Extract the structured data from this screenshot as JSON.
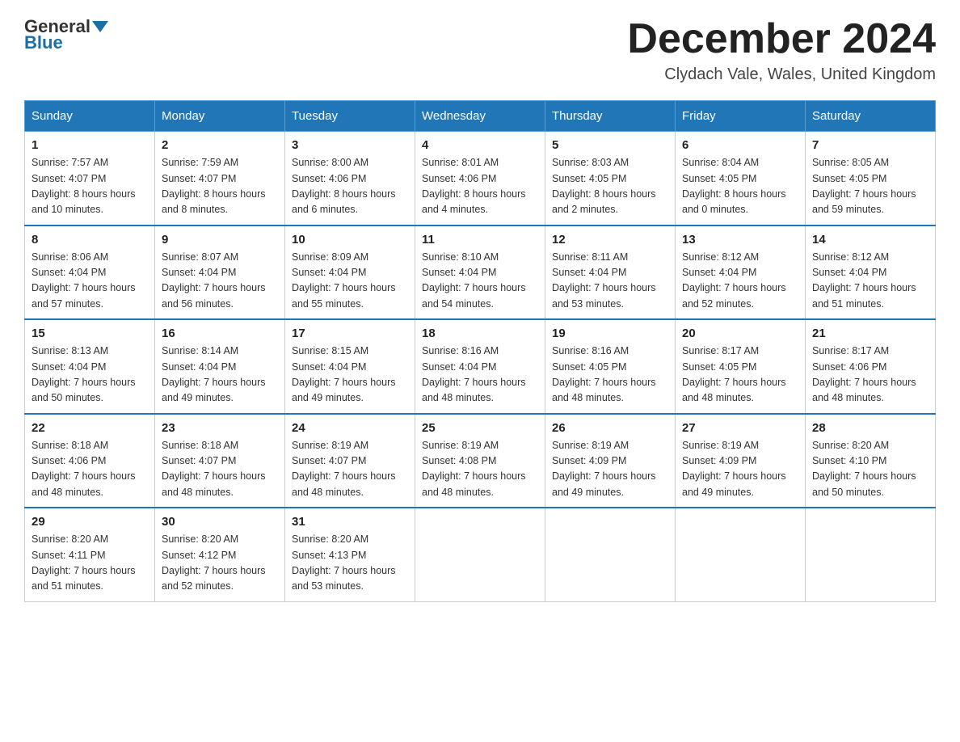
{
  "header": {
    "logo_general": "General",
    "logo_blue": "Blue",
    "month_title": "December 2024",
    "location": "Clydach Vale, Wales, United Kingdom"
  },
  "days_of_week": [
    "Sunday",
    "Monday",
    "Tuesday",
    "Wednesday",
    "Thursday",
    "Friday",
    "Saturday"
  ],
  "weeks": [
    [
      {
        "day": "1",
        "sunrise": "7:57 AM",
        "sunset": "4:07 PM",
        "daylight": "8 hours and 10 minutes."
      },
      {
        "day": "2",
        "sunrise": "7:59 AM",
        "sunset": "4:07 PM",
        "daylight": "8 hours and 8 minutes."
      },
      {
        "day": "3",
        "sunrise": "8:00 AM",
        "sunset": "4:06 PM",
        "daylight": "8 hours and 6 minutes."
      },
      {
        "day": "4",
        "sunrise": "8:01 AM",
        "sunset": "4:06 PM",
        "daylight": "8 hours and 4 minutes."
      },
      {
        "day": "5",
        "sunrise": "8:03 AM",
        "sunset": "4:05 PM",
        "daylight": "8 hours and 2 minutes."
      },
      {
        "day": "6",
        "sunrise": "8:04 AM",
        "sunset": "4:05 PM",
        "daylight": "8 hours and 0 minutes."
      },
      {
        "day": "7",
        "sunrise": "8:05 AM",
        "sunset": "4:05 PM",
        "daylight": "7 hours and 59 minutes."
      }
    ],
    [
      {
        "day": "8",
        "sunrise": "8:06 AM",
        "sunset": "4:04 PM",
        "daylight": "7 hours and 57 minutes."
      },
      {
        "day": "9",
        "sunrise": "8:07 AM",
        "sunset": "4:04 PM",
        "daylight": "7 hours and 56 minutes."
      },
      {
        "day": "10",
        "sunrise": "8:09 AM",
        "sunset": "4:04 PM",
        "daylight": "7 hours and 55 minutes."
      },
      {
        "day": "11",
        "sunrise": "8:10 AM",
        "sunset": "4:04 PM",
        "daylight": "7 hours and 54 minutes."
      },
      {
        "day": "12",
        "sunrise": "8:11 AM",
        "sunset": "4:04 PM",
        "daylight": "7 hours and 53 minutes."
      },
      {
        "day": "13",
        "sunrise": "8:12 AM",
        "sunset": "4:04 PM",
        "daylight": "7 hours and 52 minutes."
      },
      {
        "day": "14",
        "sunrise": "8:12 AM",
        "sunset": "4:04 PM",
        "daylight": "7 hours and 51 minutes."
      }
    ],
    [
      {
        "day": "15",
        "sunrise": "8:13 AM",
        "sunset": "4:04 PM",
        "daylight": "7 hours and 50 minutes."
      },
      {
        "day": "16",
        "sunrise": "8:14 AM",
        "sunset": "4:04 PM",
        "daylight": "7 hours and 49 minutes."
      },
      {
        "day": "17",
        "sunrise": "8:15 AM",
        "sunset": "4:04 PM",
        "daylight": "7 hours and 49 minutes."
      },
      {
        "day": "18",
        "sunrise": "8:16 AM",
        "sunset": "4:04 PM",
        "daylight": "7 hours and 48 minutes."
      },
      {
        "day": "19",
        "sunrise": "8:16 AM",
        "sunset": "4:05 PM",
        "daylight": "7 hours and 48 minutes."
      },
      {
        "day": "20",
        "sunrise": "8:17 AM",
        "sunset": "4:05 PM",
        "daylight": "7 hours and 48 minutes."
      },
      {
        "day": "21",
        "sunrise": "8:17 AM",
        "sunset": "4:06 PM",
        "daylight": "7 hours and 48 minutes."
      }
    ],
    [
      {
        "day": "22",
        "sunrise": "8:18 AM",
        "sunset": "4:06 PM",
        "daylight": "7 hours and 48 minutes."
      },
      {
        "day": "23",
        "sunrise": "8:18 AM",
        "sunset": "4:07 PM",
        "daylight": "7 hours and 48 minutes."
      },
      {
        "day": "24",
        "sunrise": "8:19 AM",
        "sunset": "4:07 PM",
        "daylight": "7 hours and 48 minutes."
      },
      {
        "day": "25",
        "sunrise": "8:19 AM",
        "sunset": "4:08 PM",
        "daylight": "7 hours and 48 minutes."
      },
      {
        "day": "26",
        "sunrise": "8:19 AM",
        "sunset": "4:09 PM",
        "daylight": "7 hours and 49 minutes."
      },
      {
        "day": "27",
        "sunrise": "8:19 AM",
        "sunset": "4:09 PM",
        "daylight": "7 hours and 49 minutes."
      },
      {
        "day": "28",
        "sunrise": "8:20 AM",
        "sunset": "4:10 PM",
        "daylight": "7 hours and 50 minutes."
      }
    ],
    [
      {
        "day": "29",
        "sunrise": "8:20 AM",
        "sunset": "4:11 PM",
        "daylight": "7 hours and 51 minutes."
      },
      {
        "day": "30",
        "sunrise": "8:20 AM",
        "sunset": "4:12 PM",
        "daylight": "7 hours and 52 minutes."
      },
      {
        "day": "31",
        "sunrise": "8:20 AM",
        "sunset": "4:13 PM",
        "daylight": "7 hours and 53 minutes."
      },
      null,
      null,
      null,
      null
    ]
  ],
  "labels": {
    "sunrise": "Sunrise:",
    "sunset": "Sunset:",
    "daylight": "Daylight:"
  }
}
